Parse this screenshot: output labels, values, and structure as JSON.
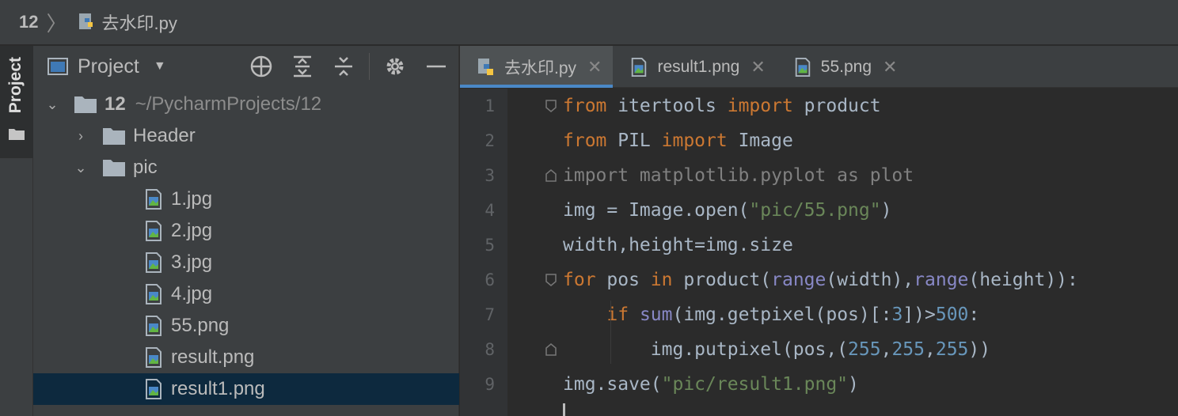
{
  "breadcrumb": {
    "root": "12",
    "file": "去水印.py"
  },
  "tool_strip": {
    "project_label": "Project"
  },
  "project_panel": {
    "title": "Project",
    "tree": [
      {
        "name": "12",
        "path": "~/PycharmProjects/12",
        "type": "folder",
        "expanded": true,
        "depth": 0
      },
      {
        "name": "Header",
        "type": "folder",
        "expanded": false,
        "depth": 1
      },
      {
        "name": "pic",
        "type": "folder",
        "expanded": true,
        "depth": 1
      },
      {
        "name": "1.jpg",
        "type": "image",
        "depth": 2
      },
      {
        "name": "2.jpg",
        "type": "image",
        "depth": 2
      },
      {
        "name": "3.jpg",
        "type": "image",
        "depth": 2
      },
      {
        "name": "4.jpg",
        "type": "image",
        "depth": 2
      },
      {
        "name": "55.png",
        "type": "image",
        "depth": 2
      },
      {
        "name": "result.png",
        "type": "image",
        "depth": 2
      },
      {
        "name": "result1.png",
        "type": "image",
        "depth": 2,
        "selected": true
      }
    ]
  },
  "editor": {
    "tabs": [
      {
        "label": "去水印.py",
        "icon": "python-icon",
        "active": true
      },
      {
        "label": "result1.png",
        "icon": "image-file-icon",
        "active": false
      },
      {
        "label": "55.png",
        "icon": "image-file-icon",
        "active": false
      }
    ],
    "lines": [
      {
        "n": "1",
        "tokens": [
          [
            "kw",
            "from"
          ],
          [
            "p",
            " itertools "
          ],
          [
            "kw",
            "import"
          ],
          [
            "p",
            " product"
          ]
        ]
      },
      {
        "n": "2",
        "tokens": [
          [
            "kw",
            "from"
          ],
          [
            "p",
            " PIL "
          ],
          [
            "kw",
            "import"
          ],
          [
            "p",
            " Image"
          ]
        ]
      },
      {
        "n": "3",
        "tokens": [
          [
            "unused",
            "import matplotlib.pyplot as plot"
          ]
        ]
      },
      {
        "n": "4",
        "tokens": [
          [
            "p",
            "img = Image.open("
          ],
          [
            "str",
            "\"pic/55.png\""
          ],
          [
            "p",
            ")"
          ]
        ]
      },
      {
        "n": "5",
        "tokens": [
          [
            "p",
            "width,height=img.size"
          ]
        ]
      },
      {
        "n": "6",
        "tokens": [
          [
            "kw",
            "for"
          ],
          [
            "p",
            " pos "
          ],
          [
            "kw",
            "in"
          ],
          [
            "p",
            " product("
          ],
          [
            "builtin",
            "range"
          ],
          [
            "p",
            "(width),"
          ],
          [
            "builtin",
            "range"
          ],
          [
            "p",
            "(height)):"
          ]
        ]
      },
      {
        "n": "7",
        "tokens": [
          [
            "p",
            "    "
          ],
          [
            "kw",
            "if"
          ],
          [
            "p",
            " "
          ],
          [
            "builtin",
            "sum"
          ],
          [
            "p",
            "(img.getpixel(pos)[:"
          ],
          [
            "num",
            "3"
          ],
          [
            "p",
            "])>"
          ],
          [
            "num",
            "500"
          ],
          [
            "p",
            ":"
          ]
        ]
      },
      {
        "n": "8",
        "tokens": [
          [
            "p",
            "        img.putpixel(pos,("
          ],
          [
            "num",
            "255"
          ],
          [
            "p",
            ","
          ],
          [
            "num",
            "255"
          ],
          [
            "p",
            ","
          ],
          [
            "num",
            "255"
          ],
          [
            "p",
            "))"
          ]
        ]
      },
      {
        "n": "9",
        "tokens": [
          [
            "p",
            "img.save("
          ],
          [
            "str",
            "\"pic/result1.png\""
          ],
          [
            "p",
            ")"
          ]
        ]
      }
    ]
  },
  "colors": {
    "keyword": "#cc7832",
    "string": "#6a8759",
    "number": "#6897bb",
    "builtin": "#8888c6",
    "plain": "#a9b7c6",
    "selection": "#0d293e",
    "tab_accent": "#4a88c7"
  }
}
